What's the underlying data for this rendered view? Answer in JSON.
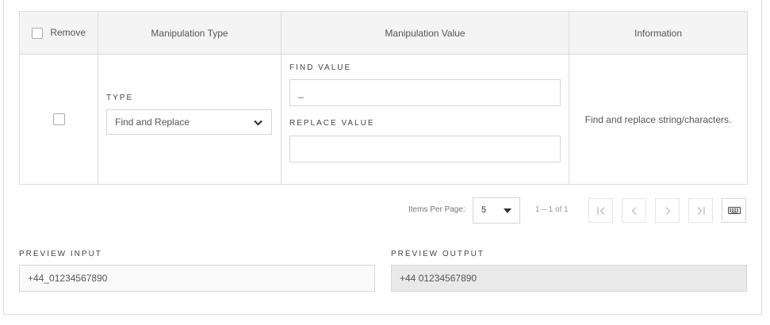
{
  "table": {
    "headers": {
      "remove": "Remove",
      "manipulation_type": "Manipulation Type",
      "manipulation_value": "Manipulation Value",
      "information": "Information"
    },
    "row": {
      "remove_checked": false,
      "type_label": "TYPE",
      "type_value": "Find and Replace",
      "find_label": "FIND VALUE",
      "find_value": "_",
      "replace_label": "REPLACE VALUE",
      "replace_value": "",
      "information": "Find and replace string/characters."
    }
  },
  "pagination": {
    "items_per_page_label": "Items Per Page:",
    "items_per_page_value": "5",
    "range": "1 – 1 of 1",
    "first_icon": "first-page-icon",
    "prev_icon": "chevron-left-icon",
    "next_icon": "chevron-right-icon",
    "last_icon": "last-page-icon",
    "keyboard_icon": "keyboard-icon"
  },
  "preview": {
    "input_label": "PREVIEW INPUT",
    "input_value": "+44_01234567890",
    "output_label": "PREVIEW OUTPUT",
    "output_value": "+44 01234567890"
  }
}
